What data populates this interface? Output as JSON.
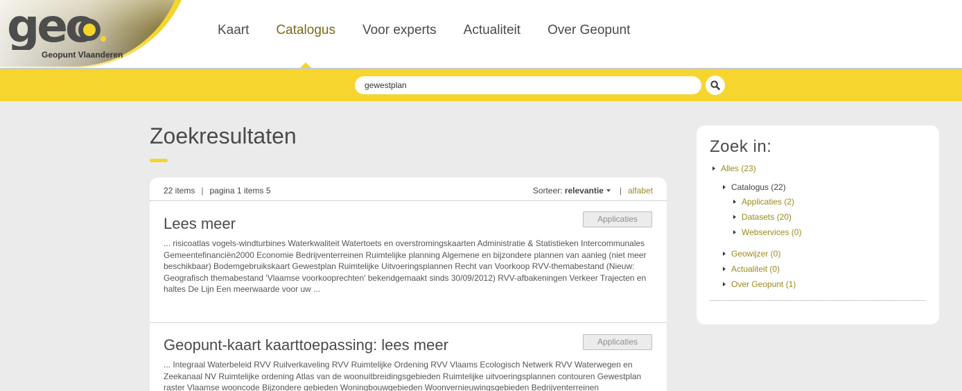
{
  "brand": {
    "logo_text": "geo",
    "subtitle": "Geopunt Vlaanderen",
    "accent": "#f4d52a"
  },
  "nav": {
    "items": [
      {
        "label": "Kaart"
      },
      {
        "label": "Catalogus"
      },
      {
        "label": "Voor experts"
      },
      {
        "label": "Actualiteit"
      },
      {
        "label": "Over Geopunt"
      }
    ],
    "active": "Catalogus"
  },
  "search": {
    "value": "gewestplan",
    "button_icon": "search-icon"
  },
  "main": {
    "title": "Zoekresultaten",
    "summary": {
      "count": "22 items",
      "page": "pagina 1 items 5",
      "sort_label": "Sorteer:",
      "sort_value": "relevantie",
      "sort_alt": "alfabet"
    },
    "results": [
      {
        "title": "Lees meer",
        "tag": "Applicaties",
        "snippet": "... risicoatlas vogels-windturbines Waterkwaliteit Watertoets en overstromingskaarten Administratie & Statistieken Intercommunales Gemeentefinanciën2000 Economie Bedrijventerreinen Ruimtelijke planning Algemene en bijzondere plannen van aanleg (niet meer beschikbaar) Bodemgebruikskaart Gewestplan Ruimtelijke Uitvoeringsplannen Recht van Voorkoop RVV-themabestand (Nieuw: Geografisch themabestand 'Vlaamse voorkooprechten' bekendgemaakt sinds 30/09/2012) RVV-afbakeningen Verkeer Trajecten en haltes De Lijn Een meerwaarde voor uw ..."
      },
      {
        "title": "Geopunt-kaart kaarttoepassing: lees meer",
        "tag": "Applicaties",
        "snippet": "... Integraal Waterbeleid RVV Ruilverkaveling RVV Ruimtelijke Ordening RVV Vlaams Ecologisch Netwerk RVV Waterwegen en Zeekanaal NV Ruimtelijke ordening Atlas van de woonuitbreidingsgebieden Ruimtelijke uitvoeringsplannen contouren Gewestplan raster Vlaamse wooncode Bijzondere gebieden Woningbouwgebieden Woonvernieuwingsgebieden Bedrijventerreinen"
      }
    ]
  },
  "sidebar": {
    "title": "Zoek in:",
    "items": [
      {
        "label": "Alles (23)"
      },
      {
        "label": "Catalogus (22)"
      },
      {
        "label": "Applicaties (2)"
      },
      {
        "label": "Datasets (20)"
      },
      {
        "label": "Webservices (0)"
      },
      {
        "label": "Geowijzer (0)"
      },
      {
        "label": "Actualiteit (0)"
      },
      {
        "label": "Over Geopunt (1)"
      }
    ]
  }
}
